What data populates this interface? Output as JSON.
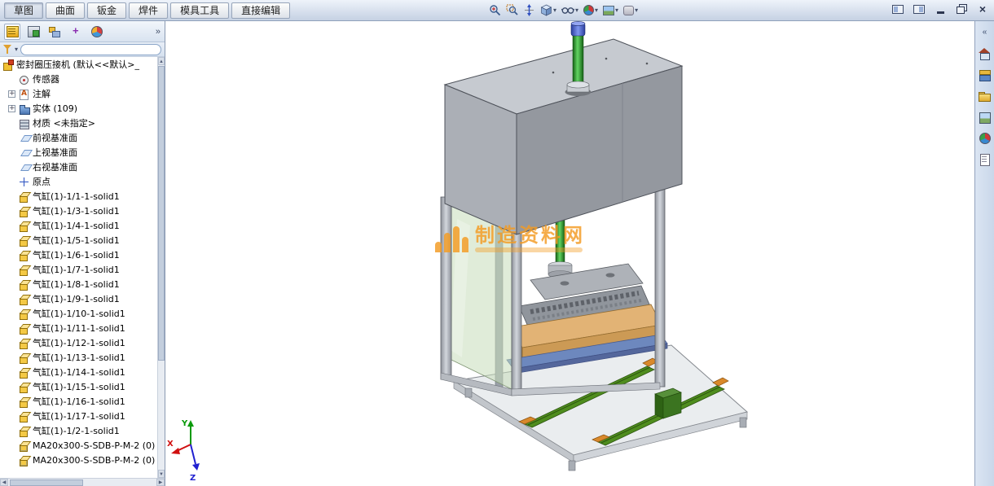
{
  "tabbar": {
    "tabs": [
      {
        "name": "tab-sketch",
        "label": "草图",
        "state": "active"
      },
      {
        "name": "tab-surfaces",
        "label": "曲面",
        "state": "normal"
      },
      {
        "name": "tab-sheet-metal",
        "label": "钣金",
        "state": "normal"
      },
      {
        "name": "tab-weldments",
        "label": "焊件",
        "state": "normal"
      },
      {
        "name": "tab-mold-tools",
        "label": "模具工具",
        "state": "normal"
      },
      {
        "name": "tab-direct-editing",
        "label": "直接编辑",
        "state": "normal"
      }
    ]
  },
  "glyphs": {
    "overflow_chevron": "»",
    "dropdown": "▾",
    "up": "▲",
    "down": "▼",
    "left": "◀",
    "right": "▶",
    "collapse_left": "«",
    "close": "×"
  },
  "icons": {
    "view_toolbar": [
      "zoom-to-fit-icon",
      "zoom-to-area-icon",
      "section-view-icon",
      "view-orientation-icon",
      "hide-show-items-icon",
      "edit-appearance-icon",
      "apply-scene-icon",
      "view-settings-icon"
    ],
    "window_controls": [
      "pane-left-icon",
      "pane-right-icon",
      "minimize-icon",
      "restore-icon",
      "close-icon"
    ],
    "feature_manager_tabs": [
      "featuremanager-tree-icon",
      "propertymanager-icon",
      "configurationmanager-icon",
      "dimxpertmanager-icon",
      "displaymanager-icon"
    ],
    "task_pane": [
      "collapse-chevron-icon",
      "home-icon",
      "design-library-icon",
      "file-explorer-icon",
      "view-palette-icon",
      "appearances-scenes-icon",
      "custom-properties-icon"
    ],
    "filter": "filter-funnel-icon",
    "watermark_logo": "bar-chart-logo-icon"
  },
  "filter": {
    "value": "",
    "placeholder": ""
  },
  "feature_tree": {
    "root": {
      "label": "密封圈压接机 (默认<<默认>_",
      "icon": "i-root"
    },
    "items": [
      {
        "label": "传感器",
        "icon": "i-sensor",
        "expand": ""
      },
      {
        "label": "注解",
        "icon": "i-note",
        "expand": "+"
      },
      {
        "label": "实体 (109)",
        "icon": "i-solids",
        "expand": "+"
      },
      {
        "label": "材质 <未指定>",
        "icon": "i-material",
        "expand": ""
      },
      {
        "label": "前视基准面",
        "icon": "i-plane",
        "expand": ""
      },
      {
        "label": "上视基准面",
        "icon": "i-plane",
        "expand": ""
      },
      {
        "label": "右视基准面",
        "icon": "i-plane",
        "expand": ""
      },
      {
        "label": "原点",
        "icon": "i-origin",
        "expand": ""
      },
      {
        "label": "气缸(1)-1/1-1-solid1",
        "icon": "i-solid",
        "expand": ""
      },
      {
        "label": "气缸(1)-1/3-1-solid1",
        "icon": "i-solid",
        "expand": ""
      },
      {
        "label": "气缸(1)-1/4-1-solid1",
        "icon": "i-solid",
        "expand": ""
      },
      {
        "label": "气缸(1)-1/5-1-solid1",
        "icon": "i-solid",
        "expand": ""
      },
      {
        "label": "气缸(1)-1/6-1-solid1",
        "icon": "i-solid",
        "expand": ""
      },
      {
        "label": "气缸(1)-1/7-1-solid1",
        "icon": "i-solid",
        "expand": ""
      },
      {
        "label": "气缸(1)-1/8-1-solid1",
        "icon": "i-solid",
        "expand": ""
      },
      {
        "label": "气缸(1)-1/9-1-solid1",
        "icon": "i-solid",
        "expand": ""
      },
      {
        "label": "气缸(1)-1/10-1-solid1",
        "icon": "i-solid",
        "expand": ""
      },
      {
        "label": "气缸(1)-1/11-1-solid1",
        "icon": "i-solid",
        "expand": ""
      },
      {
        "label": "气缸(1)-1/12-1-solid1",
        "icon": "i-solid",
        "expand": ""
      },
      {
        "label": "气缸(1)-1/13-1-solid1",
        "icon": "i-solid",
        "expand": ""
      },
      {
        "label": "气缸(1)-1/14-1-solid1",
        "icon": "i-solid",
        "expand": ""
      },
      {
        "label": "气缸(1)-1/15-1-solid1",
        "icon": "i-solid",
        "expand": ""
      },
      {
        "label": "气缸(1)-1/16-1-solid1",
        "icon": "i-solid",
        "expand": ""
      },
      {
        "label": "气缸(1)-1/17-1-solid1",
        "icon": "i-solid",
        "expand": ""
      },
      {
        "label": "气缸(1)-1/2-1-solid1",
        "icon": "i-solid",
        "expand": ""
      },
      {
        "label": "MA20x300-S-SDB-P-M-2 (0)",
        "icon": "i-comp",
        "expand": ""
      },
      {
        "label": "MA20x300-S-SDB-P-M-2 (0)",
        "icon": "i-comp",
        "expand": ""
      }
    ]
  },
  "viewport": {
    "watermark": {
      "text": "制造资料网"
    },
    "triad": {
      "x": "X",
      "y": "Y",
      "z": "Z"
    }
  },
  "colors": {
    "rail_green": "#4f8d1e",
    "machine_gray": "#c6cad0",
    "fixture_tan": "#e2b375",
    "plate_blue": "#6d88be",
    "cylinder_cap_blue": "#4a5fd0",
    "cylinder_rod_green": "#2f9a2f",
    "watermark_orange": "#f49b22",
    "panel_chrome_blue": "#d9e3f0"
  }
}
